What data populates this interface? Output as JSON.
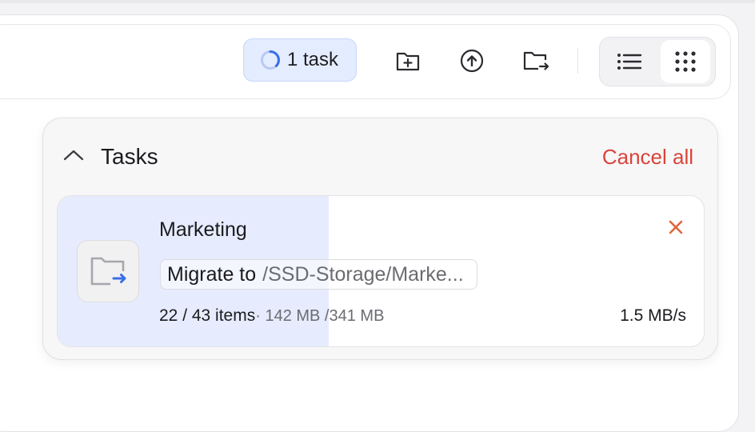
{
  "toolbar": {
    "task_indicator": {
      "label": "1 task",
      "icon": "spinner-icon"
    },
    "actions": [
      {
        "id": "new-folder",
        "icon": "folder-plus-icon"
      },
      {
        "id": "upload",
        "icon": "upload-circle-icon"
      },
      {
        "id": "move-to",
        "icon": "folder-move-icon"
      }
    ],
    "view_modes": [
      {
        "id": "list",
        "icon": "list-icon",
        "selected": false
      },
      {
        "id": "grid",
        "icon": "grid-icon",
        "selected": true
      }
    ]
  },
  "tasks_panel": {
    "title": "Tasks",
    "cancel_all_label": "Cancel all",
    "tasks": [
      {
        "name": "Marketing",
        "action": "Migrate to",
        "destination": "/SSD-Storage/Marke...",
        "items_progress": "22 / 43 items",
        "size_progress": "· 142 MB /341 MB",
        "speed": "1.5 MB/s",
        "progress": 0.42,
        "icon": "folder-migrate-icon"
      }
    ]
  },
  "colors": {
    "accent": "#3a6fe8",
    "danger": "#d9443a",
    "close": "#e0663a",
    "progress_fill": "#e6ecfd"
  }
}
